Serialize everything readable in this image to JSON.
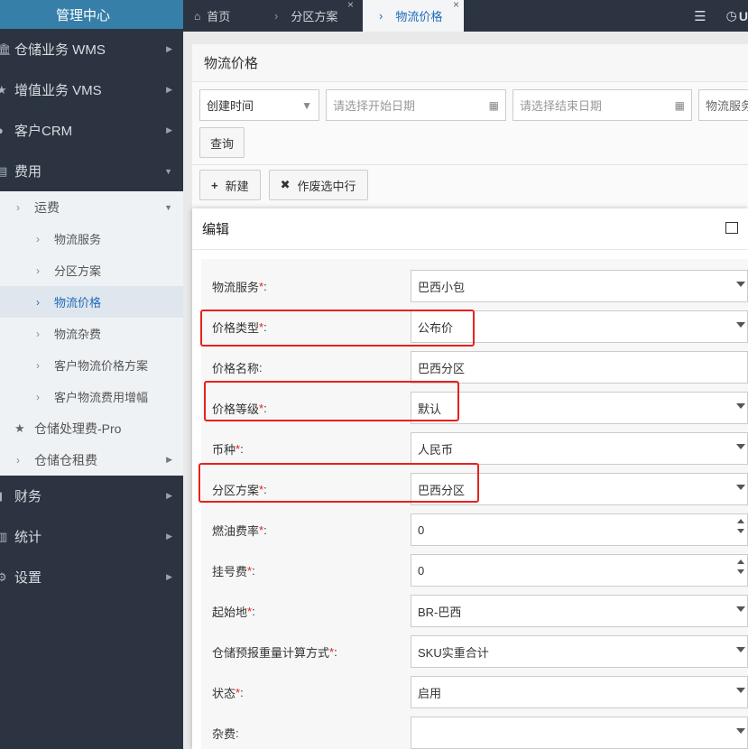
{
  "sidebar": {
    "brand": "管理中心",
    "top_items": [
      {
        "label": "仓储业务 WMS"
      },
      {
        "label": "增值业务 VMS"
      },
      {
        "label": "客户CRM"
      },
      {
        "label": "费用"
      },
      {
        "label": "财务"
      },
      {
        "label": "统计"
      },
      {
        "label": "设置"
      }
    ],
    "fee_sub": {
      "freight": "运费",
      "freight_items": [
        "物流服务",
        "分区方案",
        "物流价格",
        "物流杂费",
        "客户物流价格方案",
        "客户物流费用增幅"
      ],
      "storage_fee": "仓储处理费-Pro",
      "storage_rent": "仓储仓租费"
    }
  },
  "tabs": {
    "home": "首页",
    "zone": "分区方案",
    "price": "物流价格",
    "user_initial": "U"
  },
  "content": {
    "title": "物流价格",
    "filter": {
      "time_select": "创建时间",
      "start_placeholder": "请选择开始日期",
      "end_placeholder": "请选择结束日期",
      "service_placeholder": "物流服务"
    },
    "query_label": "查询",
    "new_label": "新建",
    "void_label": "作废选中行"
  },
  "modal": {
    "title": "编辑",
    "fields": [
      {
        "label": "物流服务",
        "required": "*",
        "colon": ":",
        "value": "巴西小包"
      },
      {
        "label": "价格类型",
        "required": "*",
        "colon": ":",
        "value": "公布价"
      },
      {
        "label": "价格名称",
        "required": "",
        "colon": ":",
        "value": "巴西分区"
      },
      {
        "label": "价格等级",
        "required": "*",
        "colon": ":",
        "value": "默认"
      },
      {
        "label": "币种",
        "required": "*",
        "colon": ":",
        "value": "人民币"
      },
      {
        "label": "分区方案",
        "required": "*",
        "colon": ":",
        "value": "巴西分区"
      },
      {
        "label": "燃油费率",
        "required": "*",
        "colon": ":",
        "value": "0"
      },
      {
        "label": "挂号费 ",
        "required": "*",
        "colon": ":",
        "value": "0"
      },
      {
        "label": "起始地 ",
        "required": "*",
        "colon": ":",
        "value": "BR-巴西"
      },
      {
        "label": "仓储预报重量计算方式",
        "required": "*",
        "colon": ":",
        "value": "SKU实重合计"
      },
      {
        "label": "状态",
        "required": "*",
        "colon": ":",
        "value": "启用"
      },
      {
        "label": "杂费",
        "required": "",
        "colon": ":",
        "value": ""
      }
    ]
  },
  "colors": {
    "sidebar_bg": "#2b3440",
    "brand_bg": "#367fa9",
    "accent": "#1e6bb8",
    "highlight_box": "#e8211d",
    "required": "#e02020"
  }
}
